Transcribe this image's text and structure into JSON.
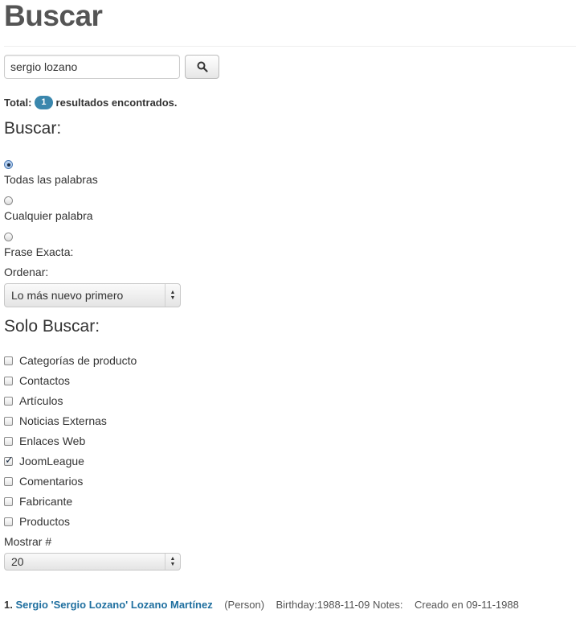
{
  "page": {
    "title": "Buscar"
  },
  "search": {
    "value": "sergio lozano",
    "button_icon": "search-icon"
  },
  "summary": {
    "prefix": "Total:",
    "count": "1",
    "suffix": "resultados encontrados."
  },
  "search_mode": {
    "heading": "Buscar:",
    "options": [
      {
        "label": "Todas las palabras",
        "checked": true
      },
      {
        "label": "Cualquier palabra",
        "checked": false
      },
      {
        "label": "Frase Exacta:",
        "checked": false
      }
    ]
  },
  "ordering": {
    "label": "Ordenar:",
    "selected": "Lo más nuevo primero"
  },
  "areas": {
    "heading": "Solo Buscar:",
    "items": [
      {
        "label": "Categorías de producto",
        "checked": false
      },
      {
        "label": "Contactos",
        "checked": false
      },
      {
        "label": "Artículos",
        "checked": false
      },
      {
        "label": "Noticias Externas",
        "checked": false
      },
      {
        "label": "Enlaces Web",
        "checked": false
      },
      {
        "label": "JoomLeague",
        "checked": true
      },
      {
        "label": "Comentarios",
        "checked": false
      },
      {
        "label": "Fabricante",
        "checked": false
      },
      {
        "label": "Productos",
        "checked": false
      }
    ]
  },
  "limit": {
    "label": "Mostrar #",
    "selected": "20"
  },
  "results": [
    {
      "number": "1.",
      "title": "Sergio 'Sergio Lozano' Lozano Martínez",
      "type": "(Person)",
      "details": "Birthday:1988-11-09 Notes:",
      "created": "Creado en 09-11-1988"
    }
  ],
  "colors": {
    "badge": "#3a87ad",
    "link": "#1f6f9f",
    "title": "#555555"
  }
}
